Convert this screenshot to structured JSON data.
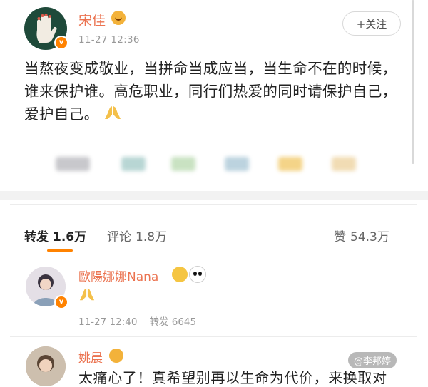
{
  "post": {
    "author": "宋佳",
    "time": "11-27 12:36",
    "follow_label": "+关注",
    "text": "当熬夜变成敬业，当拼命当成应当，当生命不在的时候，谁来保护谁。高危职业，同行们热爱的同时请保护自己，爱护自己。"
  },
  "tabs": {
    "repost_label": "转发",
    "repost_count": "1.6万",
    "comment_label": "评论",
    "comment_count": "1.8万",
    "like_label": "赞",
    "like_count": "54.3万"
  },
  "comments": [
    {
      "name": "歐陽娜娜Nana",
      "time": "11-27 12:40",
      "repost_label": "转发",
      "repost_count": "6645"
    },
    {
      "name": "姚晨",
      "text": "太痛心了！真希望别再以生命为代价，来换取对"
    }
  ],
  "watermark": "@李邦婷",
  "colors": {
    "accent": "#ff8200",
    "name": "#eb7350",
    "meta": "#999999"
  },
  "icons": {
    "pray": "pray-hands-icon",
    "verified": "verified-badge-icon"
  }
}
